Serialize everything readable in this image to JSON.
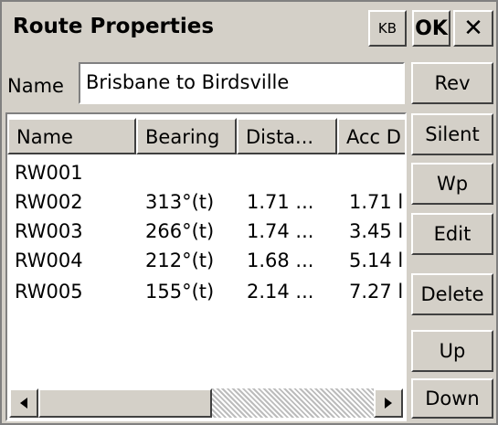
{
  "window": {
    "title": "Route Properties",
    "kb_label": "KB",
    "ok_label": "OK",
    "close_glyph": "✕"
  },
  "name_row": {
    "label": "Name",
    "value": "Brisbane to Birdsville"
  },
  "list": {
    "columns": [
      "Name",
      "Bearing",
      "Dista...",
      "Acc D"
    ],
    "rows": [
      [
        "RW001",
        "",
        "",
        ""
      ],
      [
        "RW002",
        "313°(t)",
        "1.71 ...",
        "1.71 l"
      ],
      [
        "RW003",
        "266°(t)",
        "1.74 ...",
        "3.45 l"
      ],
      [
        "RW004",
        "212°(t)",
        "1.68 ...",
        "5.14 l"
      ],
      [
        "RW005",
        "155°(t)",
        "2.14 ...",
        "7.27 l"
      ]
    ]
  },
  "buttons": {
    "rev": "Rev",
    "silent": "Silent",
    "wp": "Wp",
    "edit": "Edit",
    "delete": "Delete",
    "up": "Up",
    "down": "Down"
  },
  "icons": {
    "scroll_left": "triangle-left-icon",
    "scroll_right": "triangle-right-icon"
  }
}
